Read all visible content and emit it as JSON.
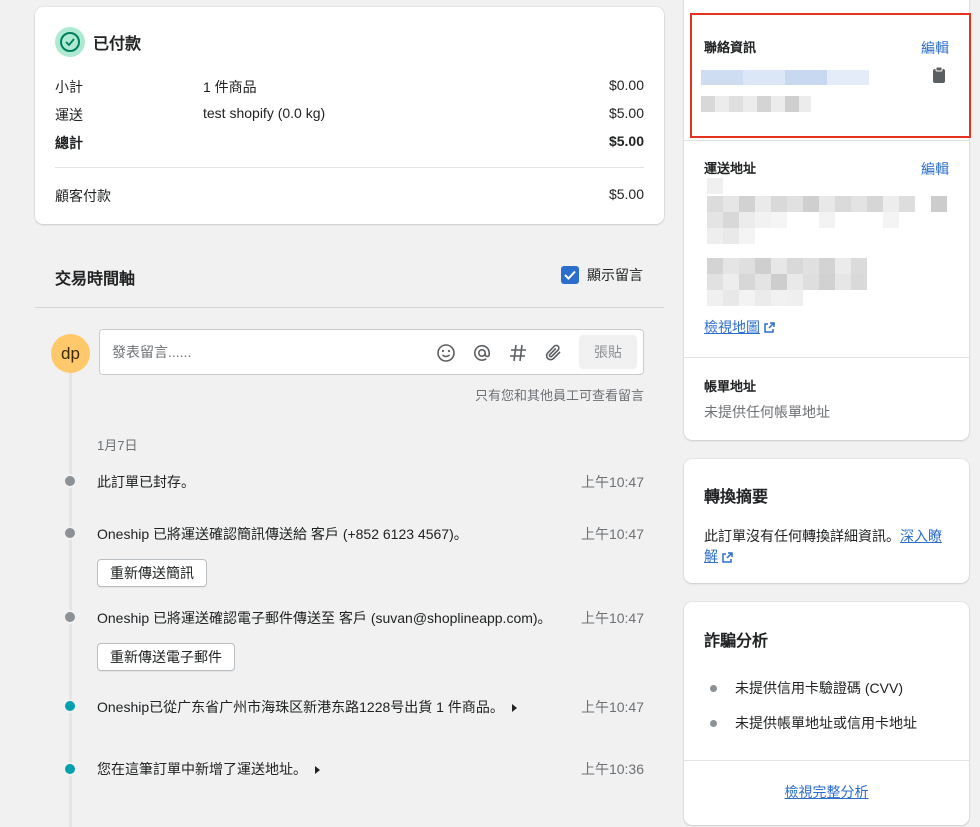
{
  "payment": {
    "status": "已付款",
    "rows": [
      {
        "label": "小計",
        "detail": "1 件商品",
        "amount": "$0.00"
      },
      {
        "label": "運送",
        "detail": "test shopify (0.0 kg)",
        "amount": "$5.00"
      },
      {
        "label": "總計",
        "detail": "",
        "amount": "$5.00"
      }
    ],
    "paid_label": "顧客付款",
    "paid_amount": "$5.00"
  },
  "timeline": {
    "title": "交易時間軸",
    "show_comments_label": "顯示留言",
    "avatar_initials": "dp",
    "comment_placeholder": "發表留言......",
    "post_label": "張貼",
    "staff_note": "只有您和其他員工可查看留言",
    "date": "1月7日",
    "events": [
      {
        "text": "此訂單已封存。",
        "time": "上午10:47"
      },
      {
        "text": "Oneship 已將運送確認簡訊傳送給 客戶 (+852 6123 4567)。",
        "time": "上午10:47",
        "button": "重新傳送簡訊"
      },
      {
        "text": "Oneship 已將運送確認電子郵件傳送至 客戶 (suvan@shoplineapp.com)。",
        "time": "上午10:47",
        "button": "重新傳送電子郵件"
      },
      {
        "text": "Oneship已從广东省广州市海珠区新港东路1228号出貨 1 件商品。",
        "time": "上午10:47"
      },
      {
        "text": "您在這筆訂單中新增了運送地址。",
        "time": "上午10:36"
      }
    ]
  },
  "customer": {
    "contact_title": "聯絡資訊",
    "contact_edit": "編輯",
    "shipping_title": "運送地址",
    "shipping_edit": "編輯",
    "view_map": "檢視地圖",
    "billing_title": "帳單地址",
    "billing_empty": "未提供任何帳單地址"
  },
  "conversion": {
    "title": "轉換摘要",
    "text": "此訂單沒有任何轉換詳細資訊。",
    "learn_more": "深入瞭解"
  },
  "fraud": {
    "title": "詐騙分析",
    "items": [
      "未提供信用卡驗證碼 (CVV)",
      "未提供帳單地址或信用卡地址"
    ],
    "view_full": "檢視完整分析"
  },
  "colors": {
    "accent": "#2c6ecb",
    "highlight": "#e53322",
    "teal_dot": "#00a0ac",
    "gray_dot": "#8c9196",
    "avatar": "#ffc96b"
  }
}
